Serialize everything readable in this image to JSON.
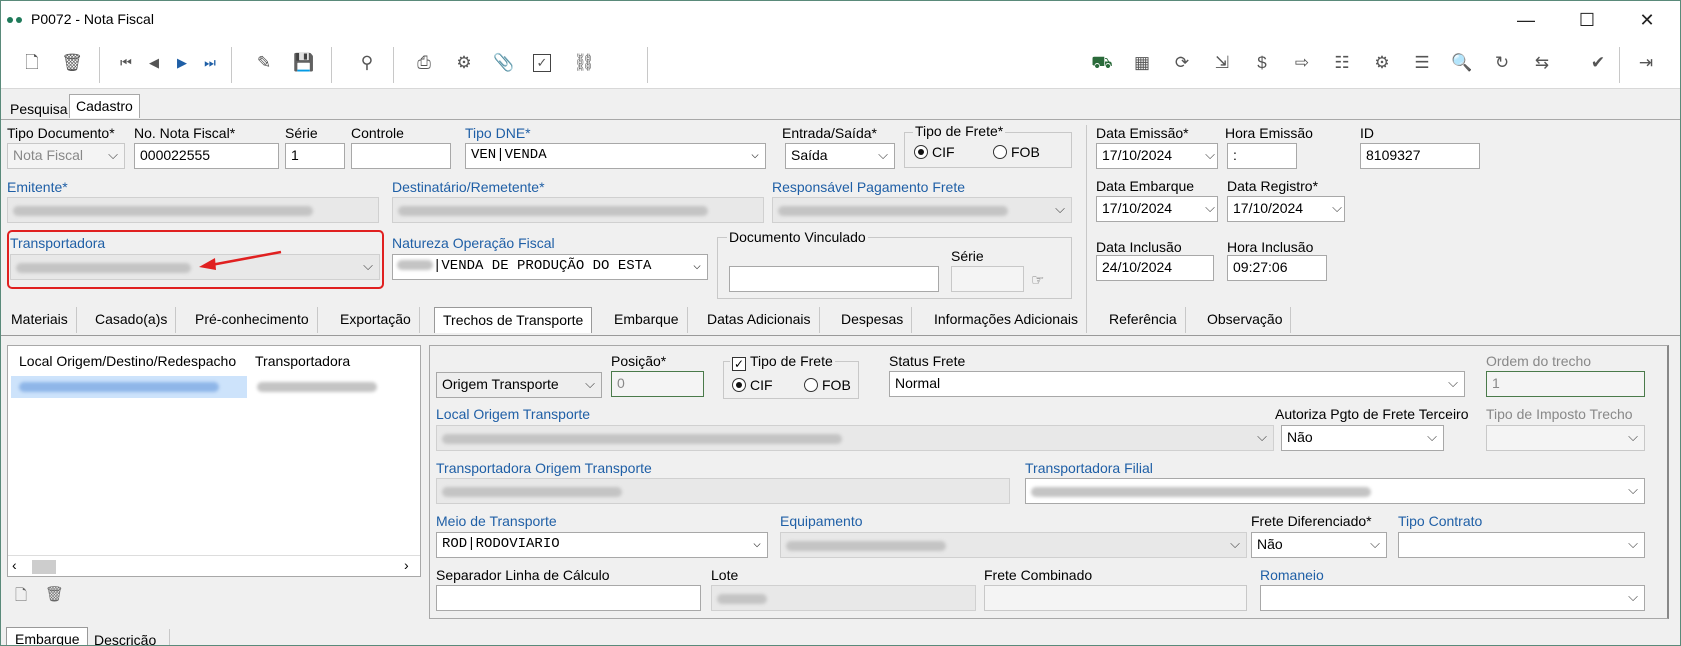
{
  "window": {
    "title": "P0072 - Nota Fiscal",
    "min": "—",
    "max": "☐",
    "close": "✕"
  },
  "toolbar": {
    "left_icons": [
      "new-doc-icon",
      "delete-icon",
      "first-record-icon",
      "prev-record-icon",
      "next-record-icon",
      "last-record-icon",
      "edit-icon",
      "save-icon",
      "binoculars-icon",
      "print-icon",
      "settings-icon",
      "attach-icon",
      "check-icon",
      "link-icon"
    ],
    "right_icons": [
      "truck-icon",
      "table-icon",
      "recalc-icon",
      "import-icon",
      "money-doc-icon",
      "export-icon",
      "tree-icon",
      "gear-cycle-icon",
      "list-icon",
      "preview-icon",
      "refresh-doc-icon",
      "transfer-icon",
      "confirm-icon",
      "exit-icon"
    ]
  },
  "tabs": [
    "Pesquisa",
    "Cadastro"
  ],
  "form": {
    "tipo_documento_label": "Tipo Documento*",
    "tipo_documento_value": "Nota Fiscal",
    "nota_label": "No. Nota Fiscal*",
    "nota_value": "000022555",
    "serie_label": "Série",
    "serie_value": "1",
    "controle_label": "Controle",
    "controle_value": "",
    "tipo_dne_label": "Tipo DNE*",
    "tipo_dne_value": "VEN|VENDA",
    "entrada_saida_label": "Entrada/Saída*",
    "entrada_saida_value": "Saída",
    "tipo_frete_label": "Tipo de Frete*",
    "cif": "CIF",
    "fob": "FOB",
    "data_emissao_label": "Data Emissão*",
    "data_emissao_value": "17/10/2024",
    "hora_emissao_label": "Hora Emissão",
    "hora_emissao_value": ":",
    "id_label": "ID",
    "id_value": "8109327",
    "emitente_label": "Emitente*",
    "destinatario_label": "Destinatário/Remetente*",
    "resp_pagamento_label": "Responsável Pagamento Frete",
    "data_embarque_label": "Data Embarque",
    "data_embarque_value": "17/10/2024",
    "data_registro_label": "Data Registro*",
    "data_registro_value": "17/10/2024",
    "transportadora_label": "Transportadora",
    "natureza_label": "Natureza Operação Fiscal",
    "natureza_value": "|VENDA DE PRODUÇÃO DO ESTA",
    "doc_vinculado_label": "Documento Vinculado",
    "doc_serie_label": "Série",
    "data_inclusao_label": "Data Inclusão",
    "data_inclusao_value": "24/10/2024",
    "hora_inclusao_label": "Hora Inclusão",
    "hora_inclusao_value": "09:27:06"
  },
  "subtabs": [
    "Materiais",
    "Casado(a)s",
    "Pré-conhecimento",
    "Exportação",
    "Trechos de Transporte",
    "Embarque",
    "Datas Adicionais",
    "Despesas",
    "Informações Adicionais",
    "Referência",
    "Observação"
  ],
  "grid": {
    "col1": "Local Origem/Destino/Redespacho",
    "col2": "Transportadora"
  },
  "trecho": {
    "origem_value": "Origem Transporte",
    "posicao_label": "Posição*",
    "posicao_value": "0",
    "tipo_frete_label": "Tipo de Frete",
    "cif": "CIF",
    "fob": "FOB",
    "status_label": "Status Frete",
    "status_value": "Normal",
    "ordem_label": "Ordem do trecho",
    "ordem_value": "1",
    "local_origem_label": "Local Origem Transporte",
    "autoriza_label": "Autoriza Pgto de Frete Terceiro",
    "autoriza_value": "Não",
    "tipo_imposto_label": "Tipo de Imposto Trecho",
    "transp_origem_label": "Transportadora Origem Transporte",
    "transp_filial_label": "Transportadora Filial",
    "meio_label": "Meio de Transporte",
    "meio_value": "ROD|RODOVIARIO",
    "equipamento_label": "Equipamento",
    "frete_dif_label": "Frete Diferenciado*",
    "frete_dif_value": "Não",
    "tipo_contrato_label": "Tipo Contrato",
    "separador_label": "Separador Linha de Cálculo",
    "lote_label": "Lote",
    "frete_combinado_label": "Frete Combinado",
    "romaneio_label": "Romaneio"
  },
  "bottom_tabs": [
    "Embarque",
    "Descrição"
  ]
}
